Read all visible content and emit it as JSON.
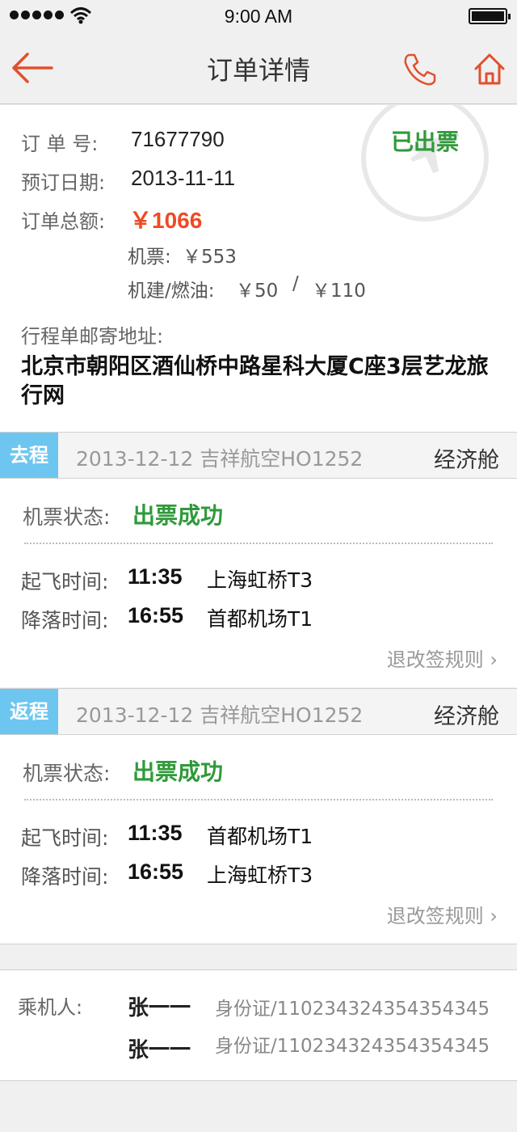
{
  "status_bar": {
    "time": "9:00 AM",
    "battery": 1.0
  },
  "nav": {
    "title": "订单详情"
  },
  "order": {
    "stamp": "已出票",
    "number_label": "订 单 号:",
    "number": "71677790",
    "date_label": "预订日期:",
    "date": "2013-11-11",
    "total_label": "订单总额:",
    "total": "￥1066",
    "ticket_label": "机票:",
    "ticket_price": "￥553",
    "tax_label": "机建/燃油:",
    "tax_value": "￥50",
    "tax_sep": "/",
    "fuel_value": "￥110",
    "address_label": "行程单邮寄地址:",
    "address": "北京市朝阳区酒仙桥中路星科大厦C座3层艺龙旅行网"
  },
  "segments": [
    {
      "tag": "去程",
      "flight": "2013-12-12  吉祥航空HO1252",
      "cabin": "经济舱",
      "status_label": "机票状态:",
      "status": "出票成功",
      "depart_label": "起飞时间:",
      "depart_time": "11:35",
      "depart_airport": "上海虹桥T3",
      "arrive_label": "降落时间:",
      "arrive_time": "16:55",
      "arrive_airport": "首都机场T1",
      "rules": "退改签规则 ›"
    },
    {
      "tag": "返程",
      "flight": "2013-12-12  吉祥航空HO1252",
      "cabin": "经济舱",
      "status_label": "机票状态:",
      "status": "出票成功",
      "depart_label": "起飞时间:",
      "depart_time": "11:35",
      "depart_airport": "首都机场T1",
      "arrive_label": "降落时间:",
      "arrive_time": "16:55",
      "arrive_airport": "上海虹桥T3",
      "rules": "退改签规则 ›"
    }
  ],
  "passengers": {
    "label": "乘机人:",
    "list": [
      {
        "name": "张一一",
        "id": "身份证/110234324354354345"
      },
      {
        "name": "张一一",
        "id": "身份证/110234324354354345"
      }
    ]
  },
  "icons": {
    "back": "arrow-left-icon",
    "phone": "phone-icon",
    "home": "home-icon",
    "plane": "airplane-icon",
    "wifi": "wifi-icon"
  },
  "colors": {
    "accent": "#e0502e",
    "success": "#2f9a3a",
    "price": "#ef4a23",
    "segment_tag": "#6dc6ef"
  }
}
